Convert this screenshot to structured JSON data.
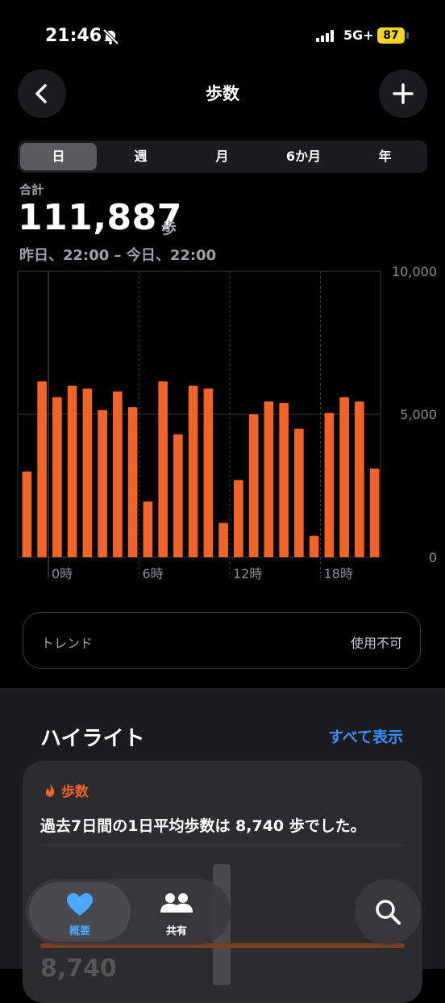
{
  "status": {
    "time": "21:46",
    "network": "5G+",
    "battery": "87"
  },
  "nav": {
    "title": "歩数"
  },
  "tabs": [
    "日",
    "週",
    "月",
    "6か月",
    "年"
  ],
  "summary": {
    "label": "合計",
    "value": "111,887",
    "unit": "歩",
    "range": "昨日、22:00 – 今日、22:00"
  },
  "chart_data": {
    "type": "bar",
    "categories": [
      "22時",
      "23時",
      "0時",
      "1時",
      "2時",
      "3時",
      "4時",
      "5時",
      "6時",
      "7時",
      "8時",
      "9時",
      "10時",
      "11時",
      "12時",
      "13時",
      "14時",
      "15時",
      "16時",
      "17時",
      "18時",
      "19時",
      "20時",
      "21時"
    ],
    "values": [
      3000,
      6150,
      5600,
      6000,
      5900,
      5150,
      5800,
      5250,
      1950,
      6150,
      4300,
      6000,
      5900,
      1200,
      2700,
      5000,
      5450,
      5400,
      4500,
      750,
      5050,
      5600,
      5450,
      3100
    ],
    "xticks": [
      "0時",
      "6時",
      "12時",
      "18時"
    ],
    "yticks": [
      "10,000",
      "5,000",
      "0"
    ],
    "ylim": [
      0,
      10000
    ],
    "color": "#f0642a"
  },
  "trend": {
    "label": "トレンド",
    "status": "使用不可"
  },
  "highlights": {
    "title": "ハイライト",
    "link": "すべて表示",
    "card": {
      "category": "歩数",
      "text": "過去7日間の1日平均歩数は 8,740 歩でした。",
      "value": "8,740"
    }
  },
  "tabbar": {
    "summary": "概要",
    "sharing": "共有"
  },
  "colors": {
    "accent": "#f0642a",
    "link": "#3a8dff",
    "heart": "#4aa8ff"
  }
}
